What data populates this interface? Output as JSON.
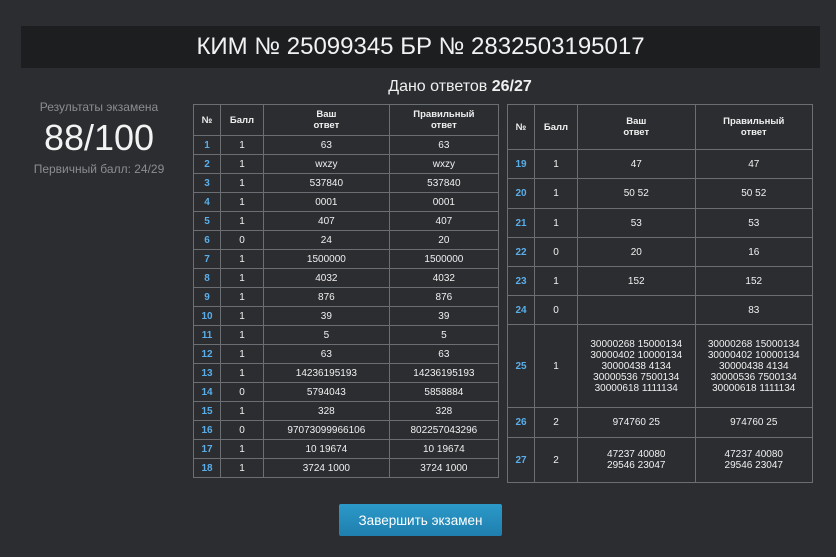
{
  "header": {
    "title": "КИМ № 25099345 БР № 2832503195017"
  },
  "answered": {
    "label": "Дано ответов",
    "value": "26/27"
  },
  "results": {
    "label": "Результаты экзамена",
    "score": "88/100",
    "primary": "Первичный балл: 24/29"
  },
  "columns": {
    "num": "№",
    "score": "Балл",
    "your": "Ваш\nответ",
    "correct": "Правильный\nответ"
  },
  "left_rows": [
    {
      "num": "1",
      "score": "1",
      "your": "63",
      "correct": "63"
    },
    {
      "num": "2",
      "score": "1",
      "your": "wxzy",
      "correct": "wxzy"
    },
    {
      "num": "3",
      "score": "1",
      "your": "537840",
      "correct": "537840"
    },
    {
      "num": "4",
      "score": "1",
      "your": "0001",
      "correct": "0001"
    },
    {
      "num": "5",
      "score": "1",
      "your": "407",
      "correct": "407"
    },
    {
      "num": "6",
      "score": "0",
      "your": "24",
      "correct": "20"
    },
    {
      "num": "7",
      "score": "1",
      "your": "1500000",
      "correct": "1500000"
    },
    {
      "num": "8",
      "score": "1",
      "your": "4032",
      "correct": "4032"
    },
    {
      "num": "9",
      "score": "1",
      "your": "876",
      "correct": "876"
    },
    {
      "num": "10",
      "score": "1",
      "your": "39",
      "correct": "39"
    },
    {
      "num": "11",
      "score": "1",
      "your": "5",
      "correct": "5"
    },
    {
      "num": "12",
      "score": "1",
      "your": "63",
      "correct": "63"
    },
    {
      "num": "13",
      "score": "1",
      "your": "14236195193",
      "correct": "14236195193"
    },
    {
      "num": "14",
      "score": "0",
      "your": "5794043",
      "correct": "5858884"
    },
    {
      "num": "15",
      "score": "1",
      "your": "328",
      "correct": "328"
    },
    {
      "num": "16",
      "score": "0",
      "your": "97073099966106",
      "correct": "802257043296"
    },
    {
      "num": "17",
      "score": "1",
      "your": "10 19674",
      "correct": "10 19674"
    },
    {
      "num": "18",
      "score": "1",
      "your": "3724 1000",
      "correct": "3724 1000"
    }
  ],
  "right_rows": [
    {
      "num": "19",
      "score": "1",
      "your": "47",
      "correct": "47"
    },
    {
      "num": "20",
      "score": "1",
      "your": "50 52",
      "correct": "50 52"
    },
    {
      "num": "21",
      "score": "1",
      "your": "53",
      "correct": "53"
    },
    {
      "num": "22",
      "score": "0",
      "your": "20",
      "correct": "16"
    },
    {
      "num": "23",
      "score": "1",
      "your": "152",
      "correct": "152"
    },
    {
      "num": "24",
      "score": "0",
      "your": "",
      "correct": "83"
    },
    {
      "num": "25",
      "score": "1",
      "your": "30000268 15000134\n30000402 10000134\n30000438 4134\n30000536 7500134\n30000618 1111134",
      "correct": "30000268 15000134\n30000402 10000134\n30000438 4134\n30000536 7500134\n30000618 1111134"
    },
    {
      "num": "26",
      "score": "2",
      "your": "974760 25",
      "correct": "974760 25"
    },
    {
      "num": "27",
      "score": "2",
      "your": "47237 40080\n29546 23047",
      "correct": "47237 40080\n29546 23047"
    }
  ],
  "finish_button": {
    "label": "Завершить экзамен"
  }
}
